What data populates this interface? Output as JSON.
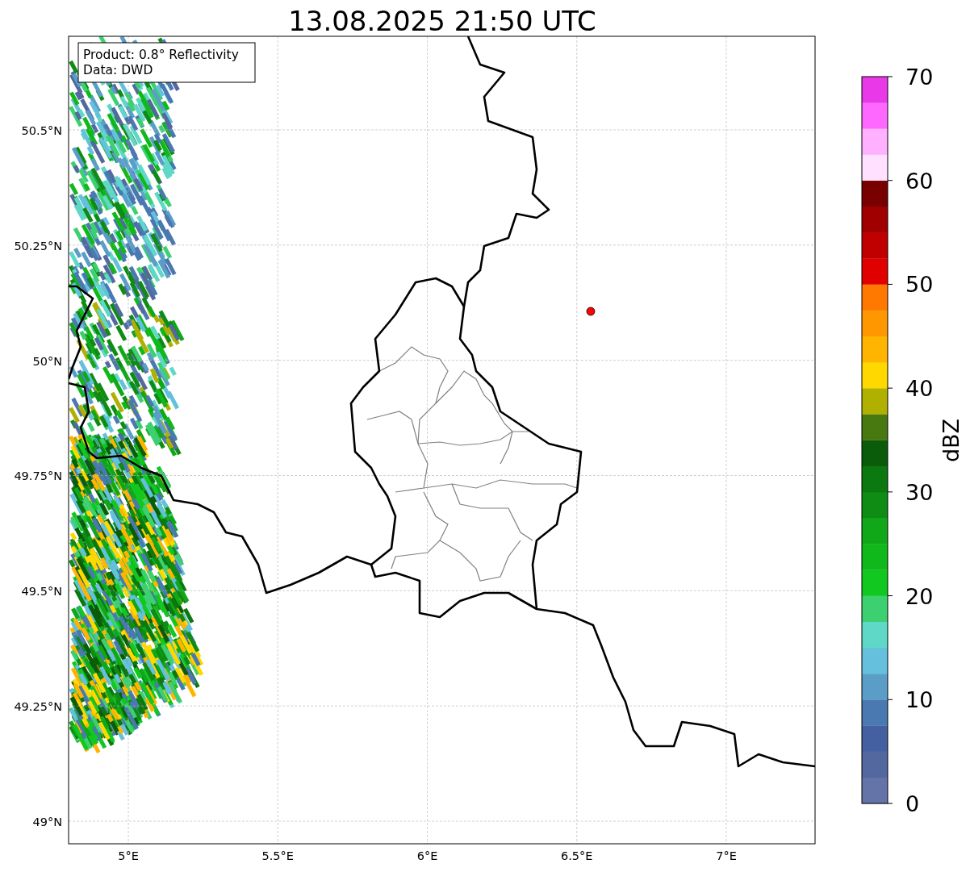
{
  "title": "13.08.2025 21:50 UTC",
  "annotation": {
    "lines": [
      "Product: 0.8° Reflectivity",
      "Data: DWD"
    ]
  },
  "y_ticks": [
    "50.5°N",
    "50.25°N",
    "50°N",
    "49.75°N",
    "49.5°N",
    "49.25°N",
    "49°N"
  ],
  "x_ticks": [
    "5°E",
    "5.5°E",
    "6°E",
    "6.5°E",
    "7°E"
  ],
  "colorbar": {
    "label": "dBZ",
    "ticks": [
      "70",
      "60",
      "50",
      "40",
      "30",
      "20",
      "10",
      "0"
    ],
    "bands": [
      {
        "color": "#6474a8"
      },
      {
        "color": "#5468a0"
      },
      {
        "color": "#4460a0"
      },
      {
        "color": "#4a78b0"
      },
      {
        "color": "#5a9ec8"
      },
      {
        "color": "#64c0dc"
      },
      {
        "color": "#60d8c8"
      },
      {
        "color": "#3cd070"
      },
      {
        "color": "#10c820"
      },
      {
        "color": "#10b81c"
      },
      {
        "color": "#10a818"
      },
      {
        "color": "#0e8c14"
      },
      {
        "color": "#0c7810"
      },
      {
        "color": "#0a5c0a"
      },
      {
        "color": "#487810"
      },
      {
        "color": "#b0b000"
      },
      {
        "color": "#ffd800"
      },
      {
        "color": "#ffb400"
      },
      {
        "color": "#ff9800"
      },
      {
        "color": "#ff7800"
      },
      {
        "color": "#e00000"
      },
      {
        "color": "#c00000"
      },
      {
        "color": "#a00000"
      },
      {
        "color": "#780000"
      },
      {
        "color": "#ffe0ff"
      },
      {
        "color": "#ffb0ff"
      },
      {
        "color": "#ff68ff"
      },
      {
        "color": "#e838e8"
      }
    ]
  }
}
